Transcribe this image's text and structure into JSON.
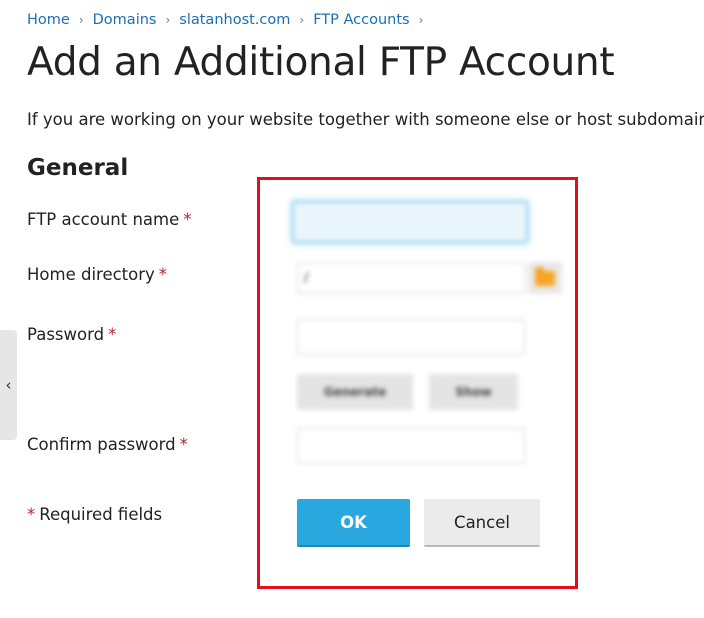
{
  "breadcrumb": {
    "items": [
      {
        "label": "Home"
      },
      {
        "label": "Domains"
      },
      {
        "label": "slatanhost.com"
      },
      {
        "label": "FTP Accounts"
      }
    ],
    "separator": "›"
  },
  "page": {
    "title": "Add an Additional FTP Account",
    "intro": "If you are working on your website together with someone else or host subdomains"
  },
  "form": {
    "section_title": "General",
    "required_mark": "*",
    "labels": {
      "ftp_account_name": "FTP account name",
      "home_directory": "Home directory",
      "password": "Password",
      "confirm_password": "Confirm password"
    },
    "values": {
      "ftp_account_name": "",
      "home_directory": "/",
      "password": "",
      "confirm_password": ""
    },
    "buttons": {
      "generate": "Generate",
      "show": "Show",
      "ok": "OK",
      "cancel": "Cancel"
    },
    "required_note": "Required fields"
  },
  "side_handle": {
    "glyph": "‹"
  },
  "colors": {
    "link": "#1a6fb5",
    "required": "#b3262e",
    "primary_button": "#29a8e0",
    "highlight": "#e3101c",
    "folder_icon": "#f5a623"
  }
}
